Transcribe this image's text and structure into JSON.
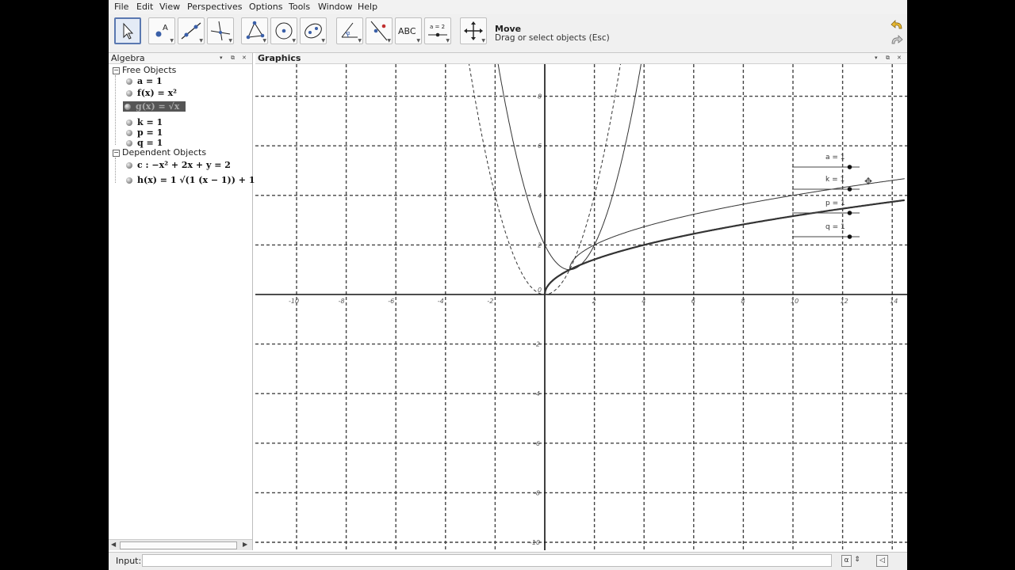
{
  "menu": [
    "File",
    "Edit",
    "View",
    "Perspectives",
    "Options",
    "Tools",
    "Window",
    "Help"
  ],
  "toolbar": {
    "tools": [
      "move-tool",
      "point-tool",
      "line-tool",
      "perpendicular-tool",
      "polygon-tool",
      "circle-tool",
      "conic-tool",
      "angle-tool",
      "reflect-tool",
      "text-tool",
      "slider-tool",
      "move-graphics-tool"
    ],
    "text_tool_label": "ABC",
    "slider_tool_label": "a = 2",
    "active_title": "Move",
    "active_help": "Drag or select objects (Esc)"
  },
  "algebra": {
    "title": "Algebra",
    "free_header": "Free Objects",
    "free": [
      "a = 1",
      "f(x) = x²",
      "g(x) = √x",
      "k = 1",
      "p = 1",
      "q = 1"
    ],
    "dependent_header": "Dependent Objects",
    "dependent": [
      "c : −x² + 2x + y = 2",
      "h(x) = 1 √(1 (x − 1)) + 1"
    ]
  },
  "graphics": {
    "title": "Graphics",
    "x_ticks": [
      "-10",
      "-8",
      "-6",
      "-4",
      "-2",
      "0",
      "2",
      "4",
      "6",
      "8",
      "10",
      "12",
      "14"
    ],
    "y_ticks": [
      "8",
      "6",
      "4",
      "2",
      "-2",
      "-4",
      "-6",
      "-8",
      "-10"
    ],
    "sliders": [
      {
        "name": "a",
        "label": "a = 1",
        "value": 1
      },
      {
        "name": "k",
        "label": "k = 1",
        "value": 1
      },
      {
        "name": "p",
        "label": "p = 1",
        "value": 1
      },
      {
        "name": "q",
        "label": "q = 1",
        "value": 1
      }
    ]
  },
  "input": {
    "label": "Input:",
    "value": "",
    "button_alpha": "α",
    "button_history": "◁"
  }
}
